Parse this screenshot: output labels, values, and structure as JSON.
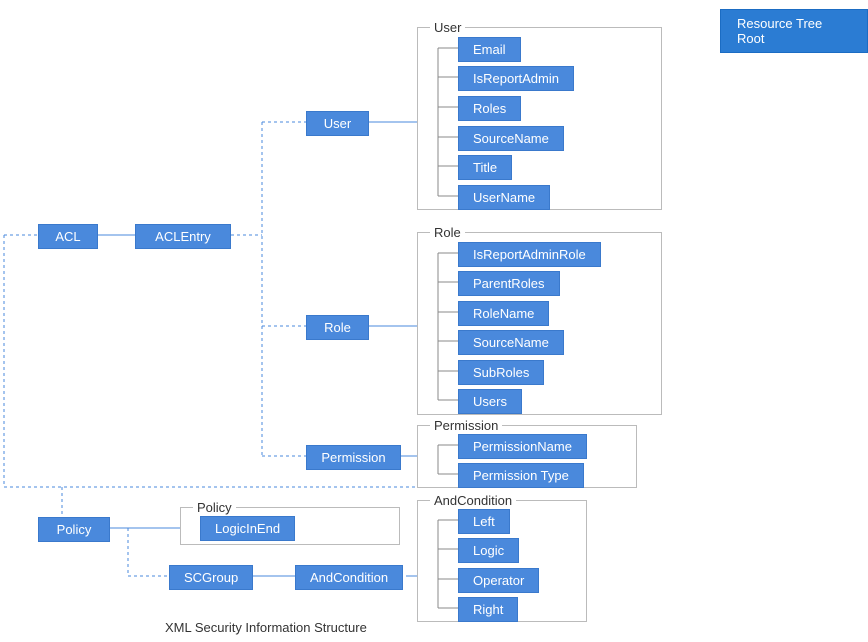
{
  "root_button": "Resource Tree Root",
  "acl": {
    "label": "ACL",
    "entry": "ACLEntry"
  },
  "user": {
    "node": "User",
    "group_label": "User",
    "props": [
      "Email",
      "IsReportAdmin",
      "Roles",
      "SourceName",
      "Title",
      "UserName"
    ]
  },
  "role": {
    "node": "Role",
    "group_label": "Role",
    "props": [
      "IsReportAdminRole",
      "ParentRoles",
      "RoleName",
      "SourceName",
      "SubRoles",
      "Users"
    ]
  },
  "permission": {
    "node": "Permission",
    "group_label": "Permission",
    "props": [
      "PermissionName",
      "Permission Type"
    ]
  },
  "policy": {
    "node": "Policy",
    "group_label": "Policy",
    "prop": "LogicInEnd"
  },
  "scgroup": {
    "node": "SCGroup"
  },
  "andcondition": {
    "node": "AndCondition",
    "group_label": "AndCondition",
    "props": [
      "Left",
      "Logic",
      "Operator",
      "Right"
    ]
  },
  "caption": "XML Security Information Structure"
}
